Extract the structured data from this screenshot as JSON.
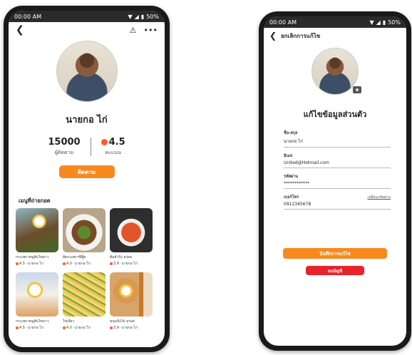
{
  "status_bar": {
    "time": "00:00 AM",
    "battery": "50%"
  },
  "profile_page": {
    "name": "นายกอ ไก่",
    "followers_count": "15000",
    "followers_label": "ผู้ติดตาม",
    "rating": "4.5",
    "rating_label": "คะแนน",
    "follow_button": "ติดตาม",
    "menu_heading": "เมนูที่ถ่ายกอด",
    "menu_items": [
      {
        "title": "กระเพราหมูสับไข่ดาว",
        "rating": "4.5",
        "author": "นายกอ ไก่"
      },
      {
        "title": "ผัดกะเพราซีฟู้ด",
        "rating": "4.0",
        "author": "นายกอ ไก่"
      },
      {
        "title": "ต้มยำกุ้ง อร่อย",
        "rating": "3.9",
        "author": "นายกอ ไก่"
      },
      {
        "title": "กระเพราหมูสับไข่ดาว",
        "rating": "4.5",
        "author": "นายกอ ไก่"
      },
      {
        "title": "ไข่เจียว",
        "rating": "4.0",
        "author": "นายกอ ไก่"
      },
      {
        "title": "ขนมปังไข่ อร่อย",
        "rating": "3.9",
        "author": "นายกอ ไก่"
      }
    ]
  },
  "edit_page": {
    "back_label": "ยกเลิกการแก้ไข",
    "section_title": "แก้ไขข้อมูลส่วนตัว",
    "fields": {
      "name": {
        "label": "ชื่อ-สกุล",
        "value": "นายกอ ไก่"
      },
      "email": {
        "label": "อีเมล",
        "value": "United@Hotmail.com"
      },
      "password": {
        "label": "รหัสผ่าน",
        "value": "************"
      },
      "phone": {
        "label": "เบอร์โทร",
        "value": "0912345678"
      }
    },
    "change_password_link": "เปลี่ยนรหัสผ่าน",
    "save_button": "บันทึกการแก้ไข",
    "delete_button": "ลบบัญชี"
  }
}
